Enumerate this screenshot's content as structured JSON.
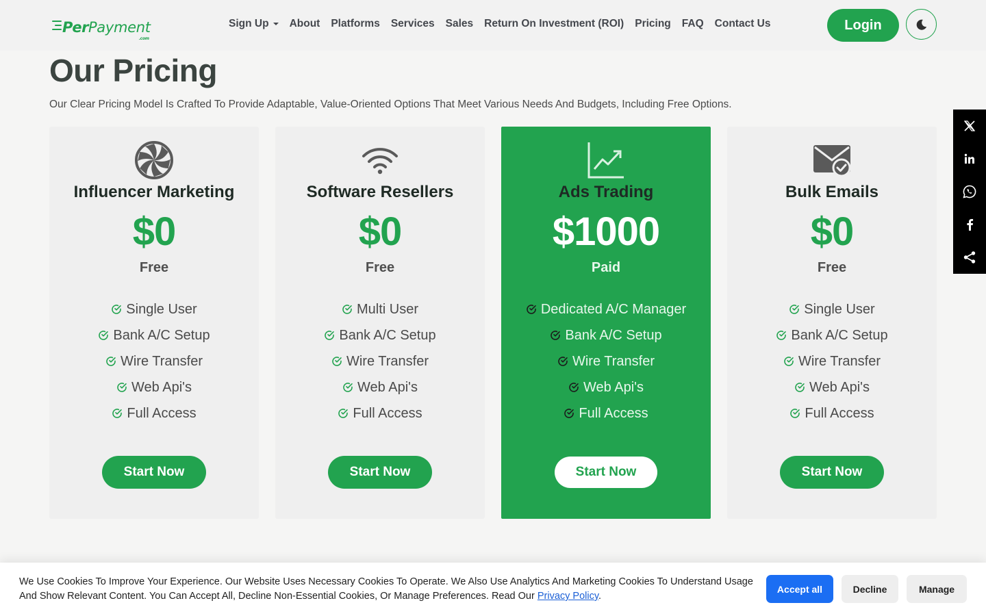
{
  "brand": {
    "name_part1": "Per",
    "name_part2": "Payment",
    "suffix": ".com",
    "color": "#22a34f"
  },
  "nav": {
    "items": [
      {
        "label": "Sign Up",
        "has_dropdown": true
      },
      {
        "label": "About"
      },
      {
        "label": "Platforms"
      },
      {
        "label": "Services"
      },
      {
        "label": "Sales"
      },
      {
        "label": "Return On Investment (ROI)"
      },
      {
        "label": "Pricing"
      },
      {
        "label": "FAQ"
      },
      {
        "label": "Contact Us"
      }
    ],
    "login_label": "Login",
    "theme_icon": "moon-icon"
  },
  "header": {
    "title": "Our Pricing",
    "subtitle": "Our Clear Pricing Model Is Crafted To Provide Adaptable, Value-Oriented Options That Meet Various Needs And Budgets, Including Free Options."
  },
  "plans": [
    {
      "icon": "aperture-icon",
      "title": "Influencer Marketing",
      "price": "$0",
      "plan": "Free",
      "features": [
        "Single User",
        "Bank A/C Setup",
        "Wire Transfer",
        "Web Api's",
        "Full Access"
      ],
      "cta": "Start Now",
      "featured": false
    },
    {
      "icon": "wifi-icon",
      "title": "Software Resellers",
      "price": "$0",
      "plan": "Free",
      "features": [
        "Multi User",
        "Bank A/C Setup",
        "Wire Transfer",
        "Web Api's",
        "Full Access"
      ],
      "cta": "Start Now",
      "featured": false
    },
    {
      "icon": "chart-line-icon",
      "title": "Ads Trading",
      "price": "$1000",
      "plan": "Paid",
      "features": [
        "Dedicated A/C Manager",
        "Bank A/C Setup",
        "Wire Transfer",
        "Web Api's",
        "Full Access"
      ],
      "cta": "Start Now",
      "featured": true
    },
    {
      "icon": "envelope-check-icon",
      "title": "Bulk Emails",
      "price": "$0",
      "plan": "Free",
      "features": [
        "Single User",
        "Bank A/C Setup",
        "Wire Transfer",
        "Web Api's",
        "Full Access"
      ],
      "cta": "Start Now",
      "featured": false
    }
  ],
  "social": {
    "items": [
      "x-icon",
      "linkedin-icon",
      "whatsapp-icon",
      "facebook-icon",
      "share-icon"
    ]
  },
  "cookie": {
    "text": "We Use Cookies To Improve Your Experience. Our Website Uses Necessary Cookies To Operate. We Also Use Analytics And Marketing Cookies To Understand Usage And Show Relevant Content. You Can Accept All, Decline Non-Essential Cookies, Or Manage Preferences. Read Our ",
    "link_label": "Privacy Policy",
    "end": ".",
    "accept_label": "Accept all",
    "decline_label": "Decline",
    "manage_label": "Manage"
  },
  "colors": {
    "accent": "#22a34f",
    "cookie_primary": "#1b6ef3"
  }
}
